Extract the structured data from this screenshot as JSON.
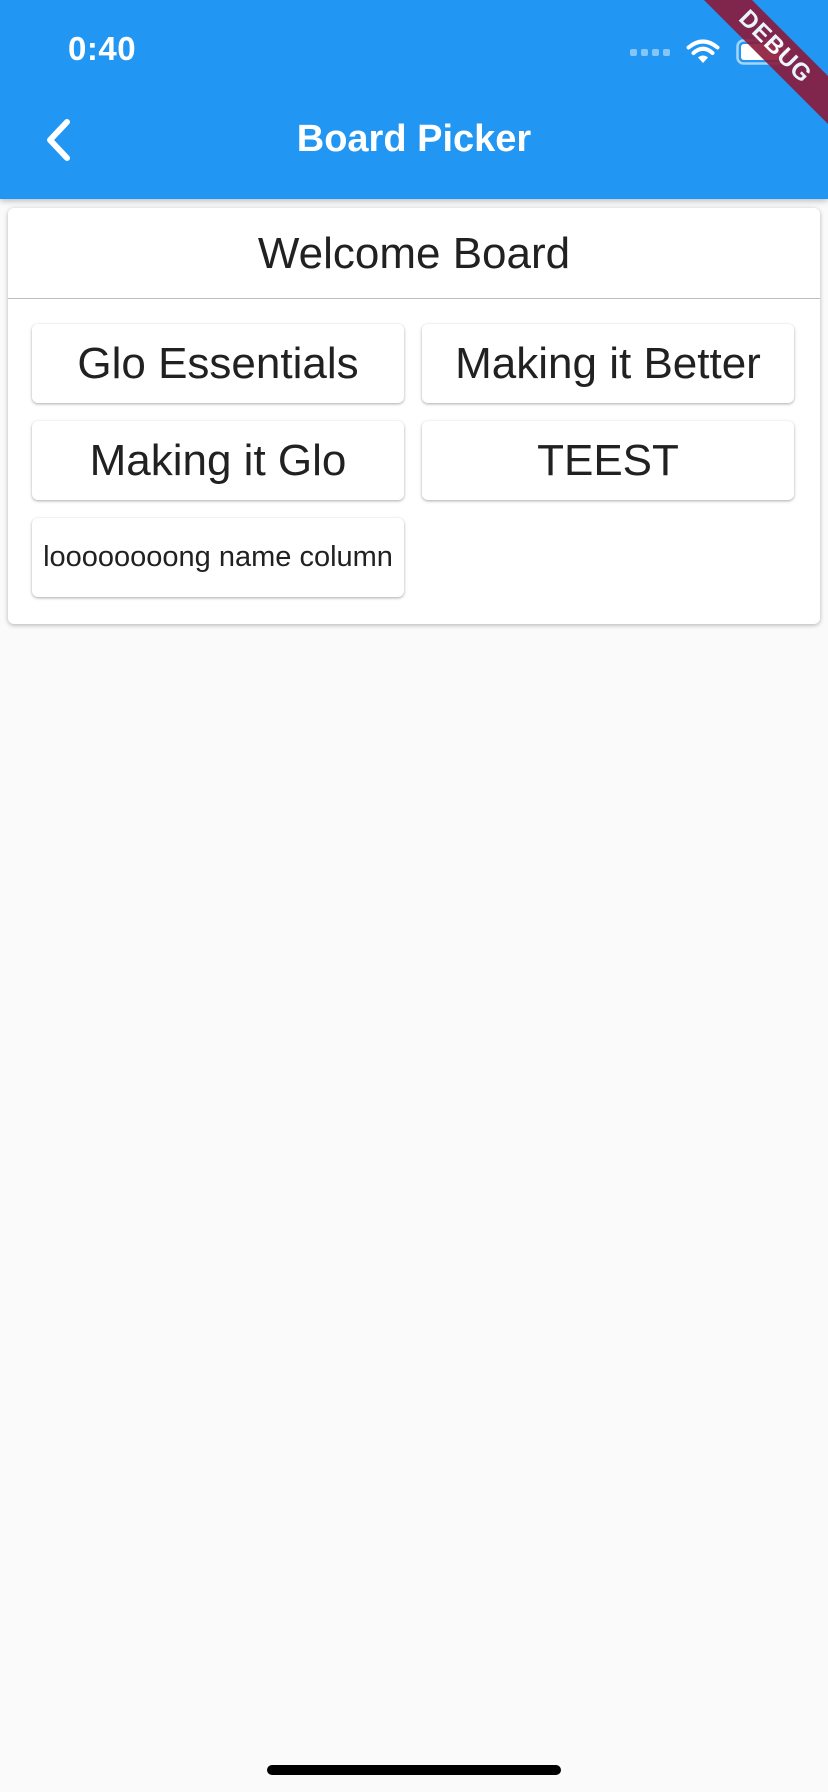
{
  "status_bar": {
    "time": "0:40"
  },
  "app_bar": {
    "title": "Board Picker",
    "background": "#2196f3",
    "back_icon": "chevron-left-icon"
  },
  "debug_banner": {
    "label": "DEBUG",
    "color": "#8b1a3a"
  },
  "board": {
    "name": "Welcome Board",
    "columns": [
      {
        "label": "Glo Essentials"
      },
      {
        "label": "Making it Better"
      },
      {
        "label": "Making it Glo"
      },
      {
        "label": "TEEST"
      },
      {
        "label": "loooooooong name column"
      }
    ]
  }
}
